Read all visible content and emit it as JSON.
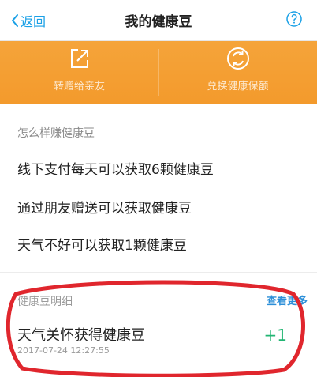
{
  "header": {
    "back_label": "返回",
    "title": "我的健康豆"
  },
  "banner": {
    "items": [
      {
        "label": "转赠给亲友",
        "icon": "share-out-icon"
      },
      {
        "label": "兑换健康保额",
        "icon": "exchange-icon"
      }
    ]
  },
  "earn_section": {
    "title": "怎么样赚健康豆",
    "items": [
      "线下支付每天可以获取6颗健康豆",
      "通过朋友赠送可以获取健康豆",
      "天气不好可以获取1颗健康豆"
    ]
  },
  "detail_section": {
    "title": "健康豆明细",
    "more_label": "查看更多",
    "record": {
      "title": "天气关怀获得健康豆",
      "time": "2017-07-24 12:27:55",
      "amount": "+1"
    }
  },
  "colors": {
    "accent": "#1aa0e6",
    "banner": "#f5a43a",
    "positive": "#22b573",
    "annotation": "#e0262d"
  }
}
